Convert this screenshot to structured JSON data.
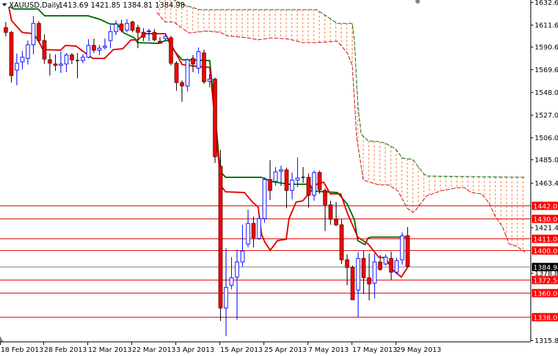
{
  "header": {
    "symbol": "XAUUSD,Daily",
    "ohlc": "1413.69 1421.85 1384.81 1384.98"
  },
  "colors": {
    "bull": "#0000ff",
    "bear": "#ff0000",
    "tenkan": "#e00000",
    "kijun": "#007000",
    "cloud_a": "#cc0000",
    "cloud_b": "#006600",
    "hatch": "#ff6a1f",
    "level": "#d80000",
    "current": "#808080"
  },
  "chart_data": {
    "type": "candlestick",
    "title": "XAUUSD,Daily",
    "ylim": [
      1315.8,
      1632.6
    ],
    "y_ticks": [
      "1632.60",
      "1611.60",
      "1590.60",
      "1569.60",
      "1548.00",
      "1527.00",
      "1506.00",
      "1485.00",
      "1463.40",
      "1421.40",
      "1378.80",
      "1315.80"
    ],
    "x_ticks": [
      {
        "bar": -1,
        "label": "18 Feb 2013"
      },
      {
        "bar": 7,
        "label": "28 Feb 2013"
      },
      {
        "bar": 15,
        "label": "12 Mar 2013"
      },
      {
        "bar": 23,
        "label": "22 Mar 2013"
      },
      {
        "bar": 31,
        "label": "3 Apr 2013"
      },
      {
        "bar": 39,
        "label": "15 Apr 2013"
      },
      {
        "bar": 47,
        "label": "25 Apr 2013"
      },
      {
        "bar": 55,
        "label": "7 May 2013"
      },
      {
        "bar": 63,
        "label": "17 May 2013"
      },
      {
        "bar": 71,
        "label": "29 May 2013"
      }
    ],
    "candles_ohlc": [
      [
        1608.7,
        1613.9,
        1600.4,
        1604.2
      ],
      [
        1604.2,
        1605.5,
        1557.2,
        1563.7
      ],
      [
        1568.8,
        1584.3,
        1554.6,
        1575.3
      ],
      [
        1576.5,
        1586.8,
        1569.5,
        1581.0
      ],
      [
        1579.8,
        1596.5,
        1574.0,
        1592.6
      ],
      [
        1592.6,
        1619.7,
        1583.6,
        1612.6
      ],
      [
        1612.6,
        1614.5,
        1594.6,
        1596.5
      ],
      [
        1596.5,
        1602.3,
        1574.6,
        1579.1
      ],
      [
        1578.5,
        1584.3,
        1563.7,
        1575.3
      ],
      [
        1574.6,
        1583.6,
        1568.2,
        1573.3
      ],
      [
        1573.3,
        1586.2,
        1566.2,
        1574.6
      ],
      [
        1574.6,
        1584.9,
        1566.9,
        1583.0
      ],
      [
        1583.0,
        1584.9,
        1574.6,
        1578.5
      ],
      [
        1577.8,
        1584.9,
        1561.1,
        1577.8
      ],
      [
        1577.8,
        1583.6,
        1575.3,
        1581.0
      ],
      [
        1581.0,
        1597.8,
        1579.8,
        1592.0
      ],
      [
        1592.0,
        1598.4,
        1584.9,
        1587.5
      ],
      [
        1587.5,
        1592.6,
        1583.0,
        1589.4
      ],
      [
        1590.1,
        1598.4,
        1588.1,
        1591.4
      ],
      [
        1596.5,
        1610.7,
        1589.4,
        1604.9
      ],
      [
        1604.9,
        1615.2,
        1601.7,
        1612.0
      ],
      [
        1612.0,
        1615.8,
        1604.2,
        1606.2
      ],
      [
        1606.2,
        1616.5,
        1604.2,
        1612.6
      ],
      [
        1613.9,
        1615.2,
        1604.2,
        1606.2
      ],
      [
        1608.7,
        1611.3,
        1589.4,
        1604.2
      ],
      [
        1604.2,
        1608.1,
        1595.9,
        1599.7
      ],
      [
        1604.9,
        1607.5,
        1595.9,
        1605.5
      ],
      [
        1604.2,
        1607.5,
        1595.9,
        1597.2
      ],
      [
        1595.9,
        1599.7,
        1593.9,
        1593.9
      ],
      [
        1598.4,
        1602.3,
        1596.5,
        1600.4
      ],
      [
        1599.1,
        1601.0,
        1573.3,
        1575.3
      ],
      [
        1575.3,
        1577.2,
        1549.5,
        1557.2
      ],
      [
        1557.2,
        1559.2,
        1539.2,
        1554.0
      ],
      [
        1554.0,
        1579.8,
        1548.9,
        1578.5
      ],
      [
        1579.8,
        1583.0,
        1566.9,
        1574.6
      ],
      [
        1570.7,
        1590.1,
        1565.6,
        1586.2
      ],
      [
        1584.9,
        1588.1,
        1555.9,
        1557.9
      ],
      [
        1558.5,
        1565.0,
        1552.7,
        1560.4
      ],
      [
        1560.4,
        1561.7,
        1481.9,
        1487.7
      ],
      [
        1478.7,
        1494.1,
        1333.8,
        1346.0
      ],
      [
        1346.0,
        1402.0,
        1319.6,
        1365.3
      ],
      [
        1367.2,
        1393.6,
        1363.4,
        1374.3
      ],
      [
        1374.9,
        1400.7,
        1335.0,
        1389.1
      ],
      [
        1389.1,
        1423.9,
        1384.6,
        1399.4
      ],
      [
        1405.9,
        1438.1,
        1402.7,
        1425.2
      ],
      [
        1425.2,
        1431.6,
        1402.7,
        1411.7
      ],
      [
        1411.0,
        1432.9,
        1409.7,
        1429.7
      ],
      [
        1429.7,
        1468.4,
        1425.8,
        1466.4
      ],
      [
        1466.4,
        1484.4,
        1447.1,
        1456.1
      ],
      [
        1464.5,
        1478.0,
        1460.6,
        1473.5
      ],
      [
        1474.1,
        1479.3,
        1460.0,
        1475.4
      ],
      [
        1475.4,
        1477.4,
        1439.4,
        1456.1
      ],
      [
        1456.1,
        1472.9,
        1447.7,
        1465.8
      ],
      [
        1465.8,
        1487.0,
        1459.3,
        1467.7
      ],
      [
        1468.4,
        1478.0,
        1463.2,
        1468.4
      ],
      [
        1468.4,
        1472.2,
        1440.0,
        1451.6
      ],
      [
        1451.6,
        1474.8,
        1446.4,
        1472.9
      ],
      [
        1472.9,
        1474.8,
        1452.9,
        1456.8
      ],
      [
        1456.1,
        1458.0,
        1418.1,
        1442.6
      ],
      [
        1442.6,
        1446.5,
        1423.9,
        1429.1
      ],
      [
        1429.1,
        1445.2,
        1422.6,
        1423.9
      ],
      [
        1423.9,
        1429.1,
        1387.2,
        1391.1
      ],
      [
        1391.1,
        1396.2,
        1367.2,
        1384.0
      ],
      [
        1384.0,
        1385.9,
        1353.7,
        1353.7
      ],
      [
        1362.7,
        1398.2,
        1337.0,
        1392.4
      ],
      [
        1392.4,
        1399.4,
        1358.9,
        1374.3
      ],
      [
        1374.3,
        1396.9,
        1353.1,
        1368.5
      ],
      [
        1369.2,
        1396.9,
        1355.0,
        1389.1
      ],
      [
        1389.1,
        1395.6,
        1380.8,
        1382.1
      ],
      [
        1387.2,
        1396.2,
        1385.9,
        1393.6
      ],
      [
        1392.4,
        1398.8,
        1372.4,
        1379.5
      ],
      [
        1379.5,
        1393.0,
        1378.2,
        1390.4
      ],
      [
        1391.1,
        1416.8,
        1386.6,
        1413.6
      ],
      [
        1413.69,
        1421.85,
        1384.81,
        1384.98
      ]
    ],
    "tenkan_sen": [
      [
        0.6,
        1628.1
      ],
      [
        1.1,
        1615.2
      ],
      [
        3,
        1604.2
      ],
      [
        5,
        1603
      ],
      [
        5.9,
        1597.1
      ],
      [
        6.8,
        1588.1
      ],
      [
        10,
        1587.5
      ],
      [
        10.9,
        1592
      ],
      [
        12.8,
        1591.4
      ],
      [
        15.3,
        1581.7
      ],
      [
        15.9,
        1579.8
      ],
      [
        18,
        1579.8
      ],
      [
        19.6,
        1588.1
      ],
      [
        21.3,
        1588.8
      ],
      [
        22.8,
        1597.1
      ],
      [
        24,
        1597.1
      ],
      [
        25.3,
        1603
      ],
      [
        29,
        1603
      ],
      [
        30.3,
        1590.7
      ],
      [
        32.1,
        1574
      ],
      [
        35.3,
        1572
      ],
      [
        37.1,
        1571.4
      ],
      [
        38,
        1525
      ],
      [
        38.8,
        1479.9
      ],
      [
        39.3,
        1459.3
      ],
      [
        40,
        1454.8
      ],
      [
        43.4,
        1454.2
      ],
      [
        45,
        1444.5
      ],
      [
        45.9,
        1440.7
      ],
      [
        46.5,
        1415.5
      ],
      [
        47.1,
        1407.8
      ],
      [
        48.1,
        1400.1
      ],
      [
        49.4,
        1409.1
      ],
      [
        51,
        1410.4
      ],
      [
        51.5,
        1429.7
      ],
      [
        52.8,
        1445.2
      ],
      [
        54,
        1446.4
      ],
      [
        55.3,
        1454.2
      ],
      [
        56.5,
        1461.9
      ],
      [
        57.8,
        1463.8
      ],
      [
        59,
        1452.9
      ],
      [
        60.9,
        1452.9
      ],
      [
        62.1,
        1434.9
      ],
      [
        64,
        1412.3
      ],
      [
        65.9,
        1405.9
      ],
      [
        67.8,
        1393.6
      ],
      [
        69,
        1393
      ],
      [
        70.3,
        1382
      ],
      [
        71.9,
        1375
      ],
      [
        72.8,
        1382
      ],
      [
        73.1,
        1384.6
      ]
    ],
    "kijun_sen": [
      [
        0.9,
        1628.1
      ],
      [
        1.5,
        1626.1
      ],
      [
        5.9,
        1626.1
      ],
      [
        7.1,
        1619.7
      ],
      [
        15,
        1619.7
      ],
      [
        17.1,
        1616.5
      ],
      [
        19,
        1612
      ],
      [
        20.3,
        1612
      ],
      [
        21.5,
        1603.6
      ],
      [
        23.4,
        1599.1
      ],
      [
        24,
        1594.6
      ],
      [
        27.8,
        1593.9
      ],
      [
        29,
        1596.5
      ],
      [
        29.6,
        1596.5
      ],
      [
        30.3,
        1589.4
      ],
      [
        31.3,
        1583
      ],
      [
        32.1,
        1578.5
      ],
      [
        37.1,
        1577.8
      ],
      [
        38,
        1531.5
      ],
      [
        38.8,
        1486.4
      ],
      [
        39.3,
        1472.2
      ],
      [
        40,
        1468.4
      ],
      [
        46.5,
        1468.4
      ],
      [
        48.4,
        1464.5
      ],
      [
        51.5,
        1461.9
      ],
      [
        55.3,
        1461.9
      ],
      [
        55.9,
        1455.5
      ],
      [
        60.3,
        1454.2
      ],
      [
        62.1,
        1443.2
      ],
      [
        63.4,
        1428.4
      ],
      [
        64,
        1409.1
      ],
      [
        65.3,
        1405.3
      ],
      [
        65.9,
        1411.7
      ],
      [
        66.5,
        1412.3
      ],
      [
        73.1,
        1412.3
      ]
    ],
    "senkou_span_a": [
      [
        27.5,
        1622.9
      ],
      [
        29,
        1613.9
      ],
      [
        30.6,
        1613.9
      ],
      [
        31.9,
        1608.7
      ],
      [
        33.4,
        1603.6
      ],
      [
        36.5,
        1605.5
      ],
      [
        39,
        1604.2
      ],
      [
        40.3,
        1601
      ],
      [
        44,
        1599.1
      ],
      [
        45.9,
        1597.2
      ],
      [
        48.4,
        1599.1
      ],
      [
        51.5,
        1597.8
      ],
      [
        54,
        1594.6
      ],
      [
        56.5,
        1594.6
      ],
      [
        60.3,
        1595.9
      ],
      [
        62.1,
        1584.9
      ],
      [
        63,
        1573.3
      ],
      [
        63.8,
        1505.7
      ],
      [
        65,
        1465.8
      ],
      [
        67.8,
        1461.3
      ],
      [
        69.6,
        1461.3
      ],
      [
        71.3,
        1455.5
      ],
      [
        73,
        1439.4
      ],
      [
        74,
        1435.5
      ],
      [
        74.6,
        1438.1
      ],
      [
        76.5,
        1451
      ],
      [
        79,
        1455.5
      ],
      [
        82.1,
        1458.7
      ],
      [
        83.4,
        1458.7
      ],
      [
        84.6,
        1454.2
      ],
      [
        86.5,
        1452.9
      ],
      [
        87.8,
        1444.5
      ],
      [
        89,
        1431.6
      ],
      [
        90.3,
        1422
      ],
      [
        91.5,
        1405.9
      ],
      [
        92.8,
        1404
      ],
      [
        94.4,
        1398.2
      ]
    ],
    "senkou_span_b": [
      [
        27.5,
        1640
      ],
      [
        30.6,
        1634.5
      ],
      [
        32.8,
        1629.3
      ],
      [
        35.3,
        1625.5
      ],
      [
        56.5,
        1625.5
      ],
      [
        59,
        1617.1
      ],
      [
        60.3,
        1612.6
      ],
      [
        63,
        1612.6
      ],
      [
        63.4,
        1595.9
      ],
      [
        64,
        1537.9
      ],
      [
        64.6,
        1508.9
      ],
      [
        65.9,
        1502.5
      ],
      [
        67.8,
        1501.8
      ],
      [
        69,
        1500.5
      ],
      [
        70.9,
        1494.8
      ],
      [
        72.1,
        1486.4
      ],
      [
        74,
        1485.1
      ],
      [
        75.9,
        1472.2
      ],
      [
        76.5,
        1469.6
      ],
      [
        94.4,
        1468.4
      ]
    ],
    "levels": [
      "1442.00",
      "1430.00",
      "1411.00",
      "1400.00",
      "1372.50",
      "1360.00",
      "1338.00"
    ],
    "current_price": "1384.98"
  }
}
